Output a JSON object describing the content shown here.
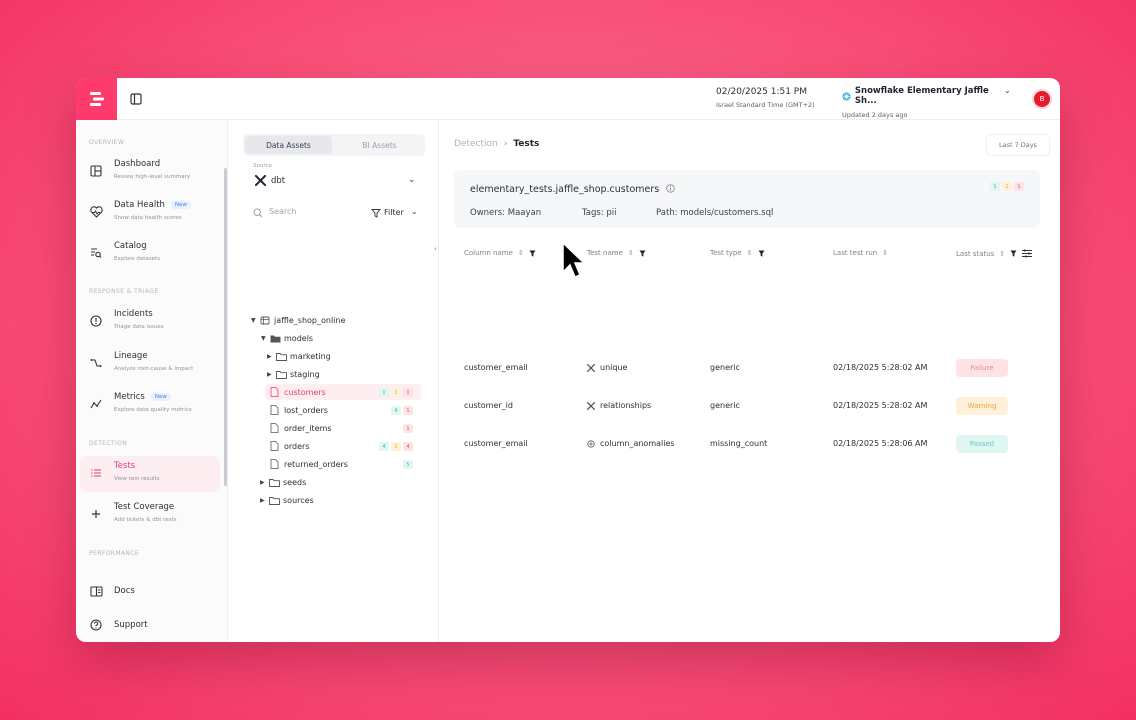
{
  "topbar": {
    "datetime": "02/20/2025 1:51 PM",
    "timezone": "Israel Standard Time (GMT+2)",
    "env_name": "Snowflake Elementary Jaffle Sh...",
    "env_updated": "Updated 2 days ago",
    "avatar_initial": "B",
    "brand_color": "#ff3b6e"
  },
  "sidebar": {
    "sections": {
      "overview": "OVERVIEW",
      "response": "RESPONSE & TRIAGE",
      "detection": "DETECTION",
      "performance": "PERFORMANCE"
    },
    "items": [
      {
        "label": "Dashboard",
        "sub": "Review high-level summary",
        "icon": "dashboard-icon"
      },
      {
        "label": "Data Health",
        "sub": "Show data health scores",
        "badge": "New",
        "icon": "heart-pulse-icon"
      },
      {
        "label": "Catalog",
        "sub": "Explore datasets",
        "icon": "catalog-icon"
      },
      {
        "label": "Incidents",
        "sub": "Triage data issues",
        "icon": "alert-circle-icon"
      },
      {
        "label": "Lineage",
        "sub": "Analyze root-cause & impact",
        "icon": "lineage-icon"
      },
      {
        "label": "Metrics",
        "sub": "Explore data quality metrics",
        "badge": "New",
        "icon": "metrics-icon"
      },
      {
        "label": "Tests",
        "sub": "View test results",
        "icon": "list-icon"
      },
      {
        "label": "Test Coverage",
        "sub": "Add tickets & dbt tests",
        "icon": "plus-icon"
      },
      {
        "label": "Docs",
        "icon": "docs-icon"
      },
      {
        "label": "Support",
        "icon": "help-icon"
      }
    ]
  },
  "assets": {
    "tabs": [
      "Data Assets",
      "BI Assets"
    ],
    "source_label": "Source",
    "source_value": "dbt",
    "search_placeholder": "Search",
    "filter_label": "Filter",
    "tree": [
      {
        "label": "jaffle_shop_online",
        "type": "database"
      },
      {
        "label": "models",
        "type": "folder"
      },
      {
        "label": "marketing",
        "type": "folder"
      },
      {
        "label": "staging",
        "type": "folder"
      },
      {
        "label": "customers",
        "type": "file",
        "counts": [
          "1",
          "1",
          "1"
        ]
      },
      {
        "label": "lost_orders",
        "type": "file",
        "counts": [
          "4",
          "1"
        ]
      },
      {
        "label": "order_items",
        "type": "file",
        "counts": [
          "1"
        ]
      },
      {
        "label": "orders",
        "type": "file",
        "counts": [
          "4",
          "1",
          "4"
        ]
      },
      {
        "label": "returned_orders",
        "type": "file",
        "counts": [
          "5"
        ]
      },
      {
        "label": "seeds",
        "type": "folder"
      },
      {
        "label": "sources",
        "type": "folder"
      }
    ]
  },
  "main": {
    "breadcrumb_parent": "Detection",
    "breadcrumb_current": "Tests",
    "time_range": "Last 7 Days",
    "card": {
      "title": "elementary_tests.jaffle_shop.customers",
      "owners": "Owners: Maayan",
      "tags": "Tags: pii",
      "path": "Path: models/customers.sql",
      "counts": [
        "1",
        "1",
        "1"
      ]
    },
    "columns": [
      "Column name",
      "Test name",
      "Test type",
      "Last test run",
      "Last status"
    ],
    "rows": [
      {
        "column": "customer_email",
        "test": "unique",
        "type": "generic",
        "run": "02/18/2025 5:28:02 AM",
        "status": "Failure"
      },
      {
        "column": "customer_id",
        "test": "relationships",
        "type": "generic",
        "run": "02/18/2025 5:28:02 AM",
        "status": "Warning"
      },
      {
        "column": "customer_email",
        "test": "column_anomalies",
        "type": "missing_count",
        "run": "02/18/2025 5:28:06 AM",
        "status": "Passed"
      }
    ]
  }
}
